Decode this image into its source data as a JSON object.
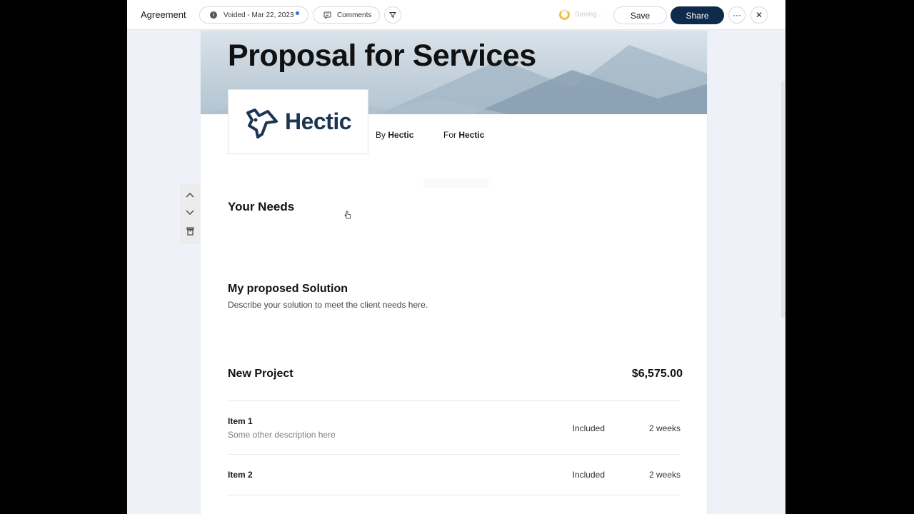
{
  "topbar": {
    "title": "Agreement",
    "status": "Voided - Mar 22, 2023",
    "comments": "Comments",
    "saving": "Saving...",
    "save": "Save",
    "share": "Share",
    "more": "···",
    "close": "✕"
  },
  "document": {
    "title": "Proposal for Services",
    "logo_text": "Hectic",
    "by_label": "By",
    "by_value": "Hectic",
    "for_label": "For",
    "for_value": "Hectic",
    "sections": {
      "needs_title": "Your Needs",
      "solution_title": "My proposed Solution",
      "solution_desc": "Describe your solution to meet the client needs here."
    },
    "project": {
      "name": "New Project",
      "total": "$6,575.00",
      "items": [
        {
          "name": "Item 1",
          "desc": "Some other description here",
          "price": "Included",
          "duration": "2 weeks"
        },
        {
          "name": "Item 2",
          "desc": "",
          "price": "Included",
          "duration": "2 weeks"
        }
      ]
    }
  },
  "colors": {
    "share_bg": "#0f2b4c",
    "spinner": "#f3c043",
    "status_dot": "#2f6fd6",
    "logo": "#1c3552"
  },
  "icons": [
    "info-icon",
    "comment-icon",
    "filter-icon",
    "spinner-icon",
    "more-icon",
    "close-icon",
    "chevron-up-icon",
    "chevron-down-icon",
    "trash-icon",
    "hand-cursor-icon",
    "bird-logo-icon"
  ]
}
